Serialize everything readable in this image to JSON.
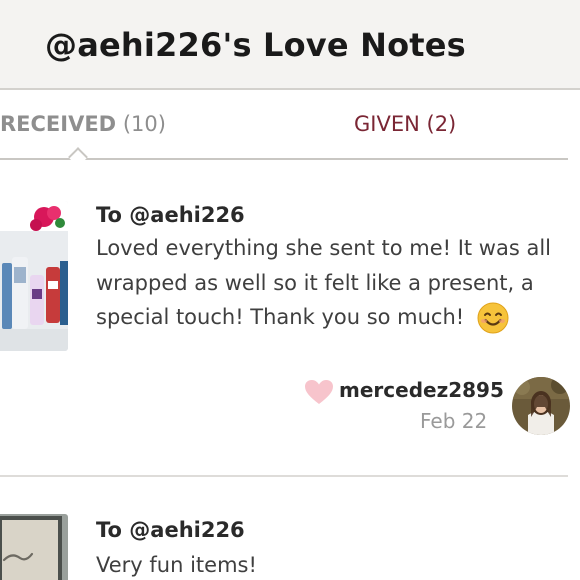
{
  "header": {
    "title": "@aehi226's Love Notes"
  },
  "tabs": [
    {
      "label": "RECEIVED",
      "count": "(10)",
      "active": true
    },
    {
      "label": "GIVEN",
      "count": "(2)",
      "active": false
    }
  ],
  "colors": {
    "header_bg": "#f4f3f1",
    "given_tab": "#7a2634",
    "heart": "#f7c4cc",
    "muted_text": "#8e8e8e"
  },
  "notes": [
    {
      "to": "To @aehi226",
      "text": "Loved everything she sent to me! It was all wrapped as well so it felt like a present, a special touch! Thank you so much!",
      "emoji": "smiling-face-icon",
      "author": "mercedez2895",
      "date": "Feb 22",
      "reaction_icon": "heart-icon"
    },
    {
      "to": "To @aehi226",
      "text": "Very fun items!"
    }
  ]
}
